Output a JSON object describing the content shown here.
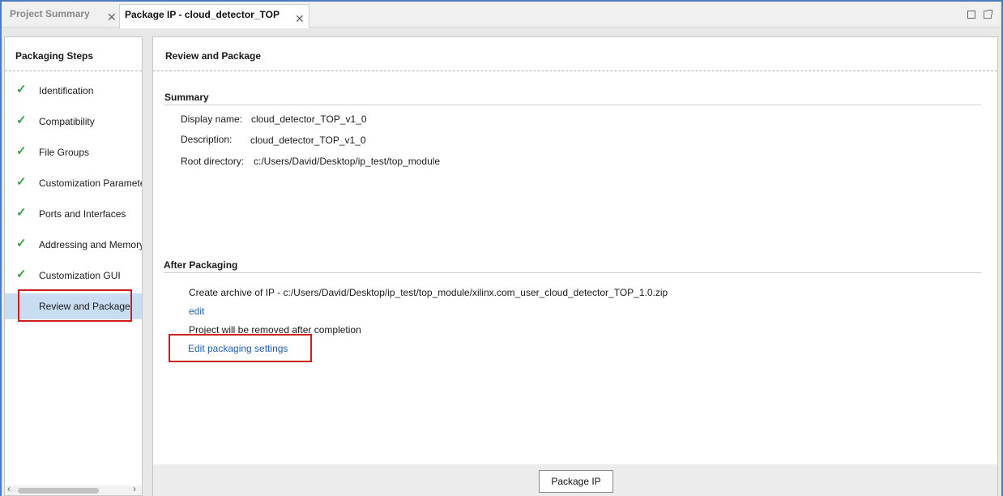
{
  "tabs": [
    {
      "label": "Project Summary",
      "active": false
    },
    {
      "label": "Package IP - cloud_detector_TOP",
      "active": true
    }
  ],
  "sidebar": {
    "title": "Packaging Steps",
    "steps": [
      {
        "label": "Identification",
        "done": true
      },
      {
        "label": "Compatibility",
        "done": true
      },
      {
        "label": "File Groups",
        "done": true
      },
      {
        "label": "Customization Parameters",
        "done": true
      },
      {
        "label": "Ports and Interfaces",
        "done": true
      },
      {
        "label": "Addressing and Memory",
        "done": true
      },
      {
        "label": "Customization GUI",
        "done": true
      },
      {
        "label": "Review and Package",
        "done": false,
        "selected": true
      }
    ]
  },
  "main": {
    "title": "Review and Package",
    "summary": {
      "heading": "Summary",
      "display_name_label": "Display name:",
      "display_name": "cloud_detector_TOP_v1_0",
      "description_label": "Description:",
      "description": "cloud_detector_TOP_v1_0",
      "root_dir_label": "Root directory:",
      "root_dir": "c:/Users/David/Desktop/ip_test/top_module"
    },
    "after": {
      "heading": "After Packaging",
      "archive_text": "Create archive of IP - c:/Users/David/Desktop/ip_test/top_module/xilinx.com_user_cloud_detector_TOP_1.0.zip",
      "edit_link": "edit",
      "removed_text": "Project will be removed after completion",
      "settings_link": "Edit packaging settings"
    },
    "package_button": "Package IP"
  },
  "icons": {
    "close": "close-icon",
    "check": "checkmark-icon",
    "maximize": "maximize-icon",
    "float": "float-window-icon"
  },
  "colors": {
    "accent_border": "#4a7cc0",
    "check_green": "#3aa04a",
    "link_blue": "#1f5fa8",
    "selected_bg": "#c8dcf2",
    "highlight_red": "#cc1f1f"
  }
}
